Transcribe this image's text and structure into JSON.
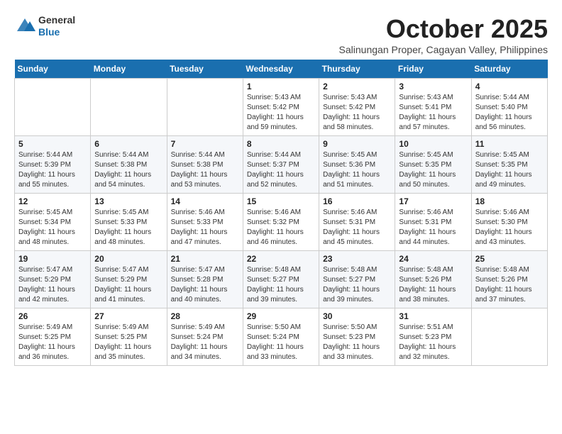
{
  "logo": {
    "general": "General",
    "blue": "Blue"
  },
  "header": {
    "month": "October 2025",
    "location": "Salinungan Proper, Cagayan Valley, Philippines"
  },
  "weekdays": [
    "Sunday",
    "Monday",
    "Tuesday",
    "Wednesday",
    "Thursday",
    "Friday",
    "Saturday"
  ],
  "weeks": [
    [
      {
        "day": "",
        "sunrise": "",
        "sunset": "",
        "daylight": ""
      },
      {
        "day": "",
        "sunrise": "",
        "sunset": "",
        "daylight": ""
      },
      {
        "day": "",
        "sunrise": "",
        "sunset": "",
        "daylight": ""
      },
      {
        "day": "1",
        "sunrise": "Sunrise: 5:43 AM",
        "sunset": "Sunset: 5:42 PM",
        "daylight": "Daylight: 11 hours and 59 minutes."
      },
      {
        "day": "2",
        "sunrise": "Sunrise: 5:43 AM",
        "sunset": "Sunset: 5:42 PM",
        "daylight": "Daylight: 11 hours and 58 minutes."
      },
      {
        "day": "3",
        "sunrise": "Sunrise: 5:43 AM",
        "sunset": "Sunset: 5:41 PM",
        "daylight": "Daylight: 11 hours and 57 minutes."
      },
      {
        "day": "4",
        "sunrise": "Sunrise: 5:44 AM",
        "sunset": "Sunset: 5:40 PM",
        "daylight": "Daylight: 11 hours and 56 minutes."
      }
    ],
    [
      {
        "day": "5",
        "sunrise": "Sunrise: 5:44 AM",
        "sunset": "Sunset: 5:39 PM",
        "daylight": "Daylight: 11 hours and 55 minutes."
      },
      {
        "day": "6",
        "sunrise": "Sunrise: 5:44 AM",
        "sunset": "Sunset: 5:38 PM",
        "daylight": "Daylight: 11 hours and 54 minutes."
      },
      {
        "day": "7",
        "sunrise": "Sunrise: 5:44 AM",
        "sunset": "Sunset: 5:38 PM",
        "daylight": "Daylight: 11 hours and 53 minutes."
      },
      {
        "day": "8",
        "sunrise": "Sunrise: 5:44 AM",
        "sunset": "Sunset: 5:37 PM",
        "daylight": "Daylight: 11 hours and 52 minutes."
      },
      {
        "day": "9",
        "sunrise": "Sunrise: 5:45 AM",
        "sunset": "Sunset: 5:36 PM",
        "daylight": "Daylight: 11 hours and 51 minutes."
      },
      {
        "day": "10",
        "sunrise": "Sunrise: 5:45 AM",
        "sunset": "Sunset: 5:35 PM",
        "daylight": "Daylight: 11 hours and 50 minutes."
      },
      {
        "day": "11",
        "sunrise": "Sunrise: 5:45 AM",
        "sunset": "Sunset: 5:35 PM",
        "daylight": "Daylight: 11 hours and 49 minutes."
      }
    ],
    [
      {
        "day": "12",
        "sunrise": "Sunrise: 5:45 AM",
        "sunset": "Sunset: 5:34 PM",
        "daylight": "Daylight: 11 hours and 48 minutes."
      },
      {
        "day": "13",
        "sunrise": "Sunrise: 5:45 AM",
        "sunset": "Sunset: 5:33 PM",
        "daylight": "Daylight: 11 hours and 48 minutes."
      },
      {
        "day": "14",
        "sunrise": "Sunrise: 5:46 AM",
        "sunset": "Sunset: 5:33 PM",
        "daylight": "Daylight: 11 hours and 47 minutes."
      },
      {
        "day": "15",
        "sunrise": "Sunrise: 5:46 AM",
        "sunset": "Sunset: 5:32 PM",
        "daylight": "Daylight: 11 hours and 46 minutes."
      },
      {
        "day": "16",
        "sunrise": "Sunrise: 5:46 AM",
        "sunset": "Sunset: 5:31 PM",
        "daylight": "Daylight: 11 hours and 45 minutes."
      },
      {
        "day": "17",
        "sunrise": "Sunrise: 5:46 AM",
        "sunset": "Sunset: 5:31 PM",
        "daylight": "Daylight: 11 hours and 44 minutes."
      },
      {
        "day": "18",
        "sunrise": "Sunrise: 5:46 AM",
        "sunset": "Sunset: 5:30 PM",
        "daylight": "Daylight: 11 hours and 43 minutes."
      }
    ],
    [
      {
        "day": "19",
        "sunrise": "Sunrise: 5:47 AM",
        "sunset": "Sunset: 5:29 PM",
        "daylight": "Daylight: 11 hours and 42 minutes."
      },
      {
        "day": "20",
        "sunrise": "Sunrise: 5:47 AM",
        "sunset": "Sunset: 5:29 PM",
        "daylight": "Daylight: 11 hours and 41 minutes."
      },
      {
        "day": "21",
        "sunrise": "Sunrise: 5:47 AM",
        "sunset": "Sunset: 5:28 PM",
        "daylight": "Daylight: 11 hours and 40 minutes."
      },
      {
        "day": "22",
        "sunrise": "Sunrise: 5:48 AM",
        "sunset": "Sunset: 5:27 PM",
        "daylight": "Daylight: 11 hours and 39 minutes."
      },
      {
        "day": "23",
        "sunrise": "Sunrise: 5:48 AM",
        "sunset": "Sunset: 5:27 PM",
        "daylight": "Daylight: 11 hours and 39 minutes."
      },
      {
        "day": "24",
        "sunrise": "Sunrise: 5:48 AM",
        "sunset": "Sunset: 5:26 PM",
        "daylight": "Daylight: 11 hours and 38 minutes."
      },
      {
        "day": "25",
        "sunrise": "Sunrise: 5:48 AM",
        "sunset": "Sunset: 5:26 PM",
        "daylight": "Daylight: 11 hours and 37 minutes."
      }
    ],
    [
      {
        "day": "26",
        "sunrise": "Sunrise: 5:49 AM",
        "sunset": "Sunset: 5:25 PM",
        "daylight": "Daylight: 11 hours and 36 minutes."
      },
      {
        "day": "27",
        "sunrise": "Sunrise: 5:49 AM",
        "sunset": "Sunset: 5:25 PM",
        "daylight": "Daylight: 11 hours and 35 minutes."
      },
      {
        "day": "28",
        "sunrise": "Sunrise: 5:49 AM",
        "sunset": "Sunset: 5:24 PM",
        "daylight": "Daylight: 11 hours and 34 minutes."
      },
      {
        "day": "29",
        "sunrise": "Sunrise: 5:50 AM",
        "sunset": "Sunset: 5:24 PM",
        "daylight": "Daylight: 11 hours and 33 minutes."
      },
      {
        "day": "30",
        "sunrise": "Sunrise: 5:50 AM",
        "sunset": "Sunset: 5:23 PM",
        "daylight": "Daylight: 11 hours and 33 minutes."
      },
      {
        "day": "31",
        "sunrise": "Sunrise: 5:51 AM",
        "sunset": "Sunset: 5:23 PM",
        "daylight": "Daylight: 11 hours and 32 minutes."
      },
      {
        "day": "",
        "sunrise": "",
        "sunset": "",
        "daylight": ""
      }
    ]
  ]
}
